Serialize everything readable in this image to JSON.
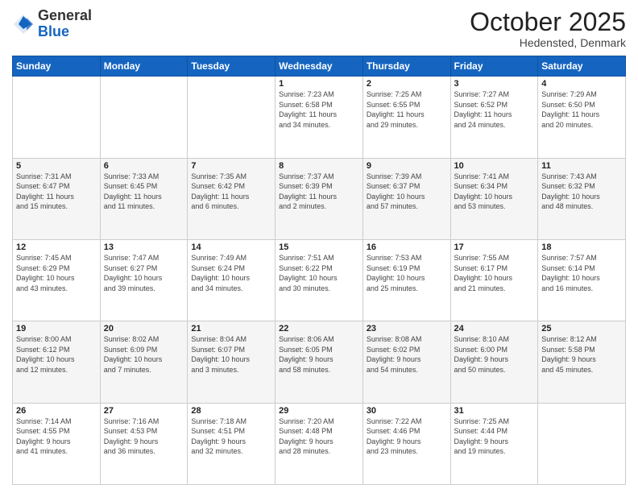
{
  "header": {
    "logo_general": "General",
    "logo_blue": "Blue",
    "month": "October 2025",
    "location": "Hedensted, Denmark"
  },
  "days_of_week": [
    "Sunday",
    "Monday",
    "Tuesday",
    "Wednesday",
    "Thursday",
    "Friday",
    "Saturday"
  ],
  "weeks": [
    [
      {
        "day": "",
        "info": ""
      },
      {
        "day": "",
        "info": ""
      },
      {
        "day": "",
        "info": ""
      },
      {
        "day": "1",
        "info": "Sunrise: 7:23 AM\nSunset: 6:58 PM\nDaylight: 11 hours\nand 34 minutes."
      },
      {
        "day": "2",
        "info": "Sunrise: 7:25 AM\nSunset: 6:55 PM\nDaylight: 11 hours\nand 29 minutes."
      },
      {
        "day": "3",
        "info": "Sunrise: 7:27 AM\nSunset: 6:52 PM\nDaylight: 11 hours\nand 24 minutes."
      },
      {
        "day": "4",
        "info": "Sunrise: 7:29 AM\nSunset: 6:50 PM\nDaylight: 11 hours\nand 20 minutes."
      }
    ],
    [
      {
        "day": "5",
        "info": "Sunrise: 7:31 AM\nSunset: 6:47 PM\nDaylight: 11 hours\nand 15 minutes."
      },
      {
        "day": "6",
        "info": "Sunrise: 7:33 AM\nSunset: 6:45 PM\nDaylight: 11 hours\nand 11 minutes."
      },
      {
        "day": "7",
        "info": "Sunrise: 7:35 AM\nSunset: 6:42 PM\nDaylight: 11 hours\nand 6 minutes."
      },
      {
        "day": "8",
        "info": "Sunrise: 7:37 AM\nSunset: 6:39 PM\nDaylight: 11 hours\nand 2 minutes."
      },
      {
        "day": "9",
        "info": "Sunrise: 7:39 AM\nSunset: 6:37 PM\nDaylight: 10 hours\nand 57 minutes."
      },
      {
        "day": "10",
        "info": "Sunrise: 7:41 AM\nSunset: 6:34 PM\nDaylight: 10 hours\nand 53 minutes."
      },
      {
        "day": "11",
        "info": "Sunrise: 7:43 AM\nSunset: 6:32 PM\nDaylight: 10 hours\nand 48 minutes."
      }
    ],
    [
      {
        "day": "12",
        "info": "Sunrise: 7:45 AM\nSunset: 6:29 PM\nDaylight: 10 hours\nand 43 minutes."
      },
      {
        "day": "13",
        "info": "Sunrise: 7:47 AM\nSunset: 6:27 PM\nDaylight: 10 hours\nand 39 minutes."
      },
      {
        "day": "14",
        "info": "Sunrise: 7:49 AM\nSunset: 6:24 PM\nDaylight: 10 hours\nand 34 minutes."
      },
      {
        "day": "15",
        "info": "Sunrise: 7:51 AM\nSunset: 6:22 PM\nDaylight: 10 hours\nand 30 minutes."
      },
      {
        "day": "16",
        "info": "Sunrise: 7:53 AM\nSunset: 6:19 PM\nDaylight: 10 hours\nand 25 minutes."
      },
      {
        "day": "17",
        "info": "Sunrise: 7:55 AM\nSunset: 6:17 PM\nDaylight: 10 hours\nand 21 minutes."
      },
      {
        "day": "18",
        "info": "Sunrise: 7:57 AM\nSunset: 6:14 PM\nDaylight: 10 hours\nand 16 minutes."
      }
    ],
    [
      {
        "day": "19",
        "info": "Sunrise: 8:00 AM\nSunset: 6:12 PM\nDaylight: 10 hours\nand 12 minutes."
      },
      {
        "day": "20",
        "info": "Sunrise: 8:02 AM\nSunset: 6:09 PM\nDaylight: 10 hours\nand 7 minutes."
      },
      {
        "day": "21",
        "info": "Sunrise: 8:04 AM\nSunset: 6:07 PM\nDaylight: 10 hours\nand 3 minutes."
      },
      {
        "day": "22",
        "info": "Sunrise: 8:06 AM\nSunset: 6:05 PM\nDaylight: 9 hours\nand 58 minutes."
      },
      {
        "day": "23",
        "info": "Sunrise: 8:08 AM\nSunset: 6:02 PM\nDaylight: 9 hours\nand 54 minutes."
      },
      {
        "day": "24",
        "info": "Sunrise: 8:10 AM\nSunset: 6:00 PM\nDaylight: 9 hours\nand 50 minutes."
      },
      {
        "day": "25",
        "info": "Sunrise: 8:12 AM\nSunset: 5:58 PM\nDaylight: 9 hours\nand 45 minutes."
      }
    ],
    [
      {
        "day": "26",
        "info": "Sunrise: 7:14 AM\nSunset: 4:55 PM\nDaylight: 9 hours\nand 41 minutes."
      },
      {
        "day": "27",
        "info": "Sunrise: 7:16 AM\nSunset: 4:53 PM\nDaylight: 9 hours\nand 36 minutes."
      },
      {
        "day": "28",
        "info": "Sunrise: 7:18 AM\nSunset: 4:51 PM\nDaylight: 9 hours\nand 32 minutes."
      },
      {
        "day": "29",
        "info": "Sunrise: 7:20 AM\nSunset: 4:48 PM\nDaylight: 9 hours\nand 28 minutes."
      },
      {
        "day": "30",
        "info": "Sunrise: 7:22 AM\nSunset: 4:46 PM\nDaylight: 9 hours\nand 23 minutes."
      },
      {
        "day": "31",
        "info": "Sunrise: 7:25 AM\nSunset: 4:44 PM\nDaylight: 9 hours\nand 19 minutes."
      },
      {
        "day": "",
        "info": ""
      }
    ]
  ]
}
